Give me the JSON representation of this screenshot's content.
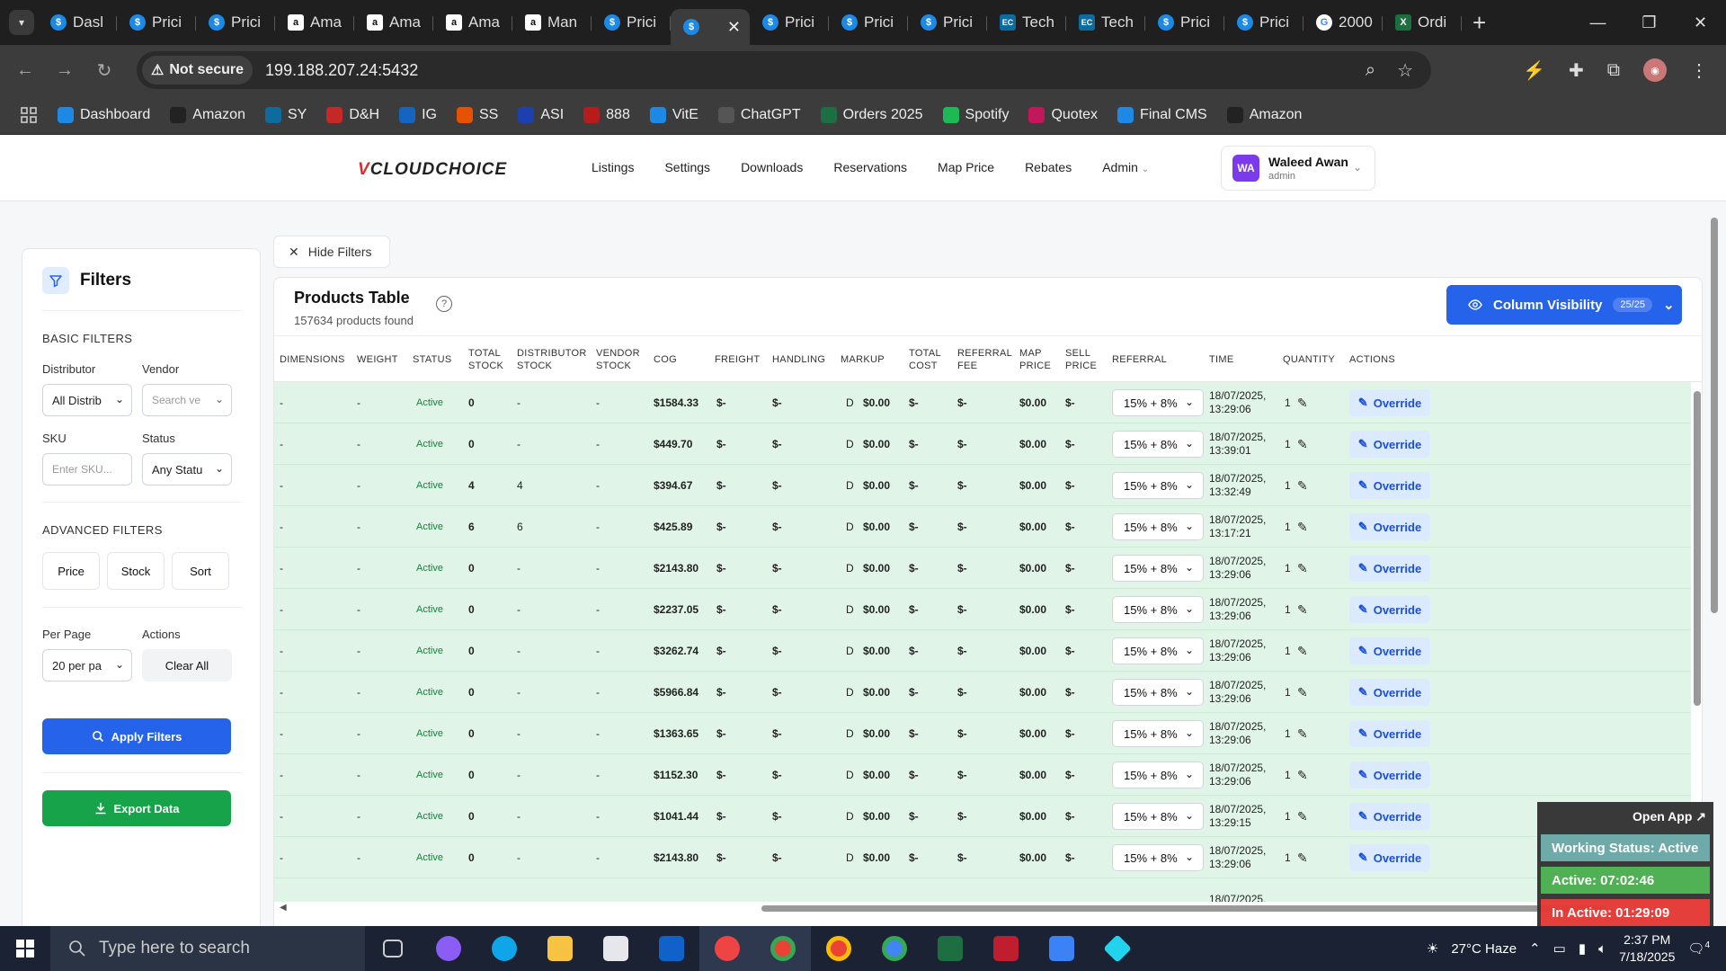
{
  "browser": {
    "tabs": [
      {
        "label": "Dasl",
        "icon": "s"
      },
      {
        "label": "Prici",
        "icon": "s"
      },
      {
        "label": "Prici",
        "icon": "s"
      },
      {
        "label": "Ama",
        "icon": "a"
      },
      {
        "label": "Ama",
        "icon": "a"
      },
      {
        "label": "Ama",
        "icon": "a"
      },
      {
        "label": "Man",
        "icon": "a"
      },
      {
        "label": "Prici",
        "icon": "s"
      },
      {
        "label": "",
        "icon": "s"
      },
      {
        "label": "Prici",
        "icon": "s"
      },
      {
        "label": "Prici",
        "icon": "s"
      },
      {
        "label": "Prici",
        "icon": "s"
      },
      {
        "label": "Tech",
        "icon": "ec"
      },
      {
        "label": "Tech",
        "icon": "ec"
      },
      {
        "label": "Prici",
        "icon": "s"
      },
      {
        "label": "Prici",
        "icon": "s"
      },
      {
        "label": "2000",
        "icon": "g"
      },
      {
        "label": "Ordi",
        "icon": "x"
      }
    ],
    "security_label": "Not secure",
    "url": "199.188.207.24:5432",
    "bookmarks": [
      {
        "label": "Dashboard",
        "color": "#1e88e5"
      },
      {
        "label": "Amazon",
        "color": "#222222"
      },
      {
        "label": "SY",
        "color": "#0d6b9e"
      },
      {
        "label": "D&H",
        "color": "#c62828"
      },
      {
        "label": "IG",
        "color": "#1565c0"
      },
      {
        "label": "SS",
        "color": "#e65100"
      },
      {
        "label": "ASI",
        "color": "#1e40af"
      },
      {
        "label": "888",
        "color": "#b71c1c"
      },
      {
        "label": "VitE",
        "color": "#1e88e5"
      },
      {
        "label": "ChatGPT",
        "color": "#555555"
      },
      {
        "label": "Orders 2025",
        "color": "#1d6f42"
      },
      {
        "label": "Spotify",
        "color": "#1db954"
      },
      {
        "label": "Quotex",
        "color": "#c2185b"
      },
      {
        "label": "Final CMS",
        "color": "#1e88e5"
      },
      {
        "label": "Amazon",
        "color": "#222222"
      }
    ]
  },
  "app": {
    "logo_v": "V",
    "logo_text": "CLOUDCHOICE",
    "nav": [
      "Listings",
      "Settings",
      "Downloads",
      "Reservations",
      "Map Price",
      "Rebates",
      "Admin"
    ],
    "user": {
      "initials": "WA",
      "name": "Waleed Awan",
      "role": "admin"
    }
  },
  "filters": {
    "title": "Filters",
    "basic_title": "BASIC FILTERS",
    "distributor_label": "Distributor",
    "distributor_value": "All Distrib",
    "vendor_label": "Vendor",
    "vendor_placeholder": "Search ve",
    "sku_label": "SKU",
    "sku_placeholder": "Enter SKU...",
    "status_label": "Status",
    "status_value": "Any Statu",
    "advanced_title": "ADVANCED FILTERS",
    "price_btn": "Price",
    "stock_btn": "Stock",
    "sort_btn": "Sort",
    "per_page_label": "Per Page",
    "per_page_value": "20 per pa",
    "actions_label": "Actions",
    "clear_all": "Clear All",
    "apply": "Apply Filters",
    "export": "Export Data"
  },
  "hide_filters": "Hide Filters",
  "table": {
    "title": "Products Table",
    "count": "157634 products found",
    "column_visibility": "Column Visibility",
    "column_badge": "25/25",
    "headers": [
      [
        "DIMENSIONS"
      ],
      [
        "WEIGHT"
      ],
      [
        "STATUS"
      ],
      [
        "TOTAL",
        "STOCK"
      ],
      [
        "DISTRIBUTOR",
        "STOCK"
      ],
      [
        "VENDOR",
        "STOCK"
      ],
      [
        "COG"
      ],
      [
        "FREIGHT"
      ],
      [
        "HANDLING"
      ],
      [
        "MARKUP"
      ],
      [
        "TOTAL",
        "COST"
      ],
      [
        "REFERRAL",
        "FEE"
      ],
      [
        "MAP",
        "PRICE"
      ],
      [
        "SELL",
        "PRICE"
      ],
      [
        "REFERRAL"
      ],
      [
        "TIME"
      ],
      [
        "QUANTITY"
      ],
      [
        "ACTIONS"
      ]
    ],
    "rows": [
      {
        "dim": "-",
        "weight": "-",
        "status": "Active",
        "total_stock": "0",
        "dist_stock": "-",
        "vendor_stock": "-",
        "cog": "$1584.33",
        "freight": "$-",
        "handling": "$-",
        "markup_d": "D",
        "markup": "$0.00",
        "total_cost": "$-",
        "ref_fee": "$-",
        "map": "$0.00",
        "sell": "$-",
        "referral": "15% + 8%",
        "date": "18/07/2025,",
        "time": "13:29:06",
        "qty": "1",
        "action": "Override"
      },
      {
        "dim": "-",
        "weight": "-",
        "status": "Active",
        "total_stock": "0",
        "dist_stock": "-",
        "vendor_stock": "-",
        "cog": "$449.70",
        "freight": "$-",
        "handling": "$-",
        "markup_d": "D",
        "markup": "$0.00",
        "total_cost": "$-",
        "ref_fee": "$-",
        "map": "$0.00",
        "sell": "$-",
        "referral": "15% + 8%",
        "date": "18/07/2025,",
        "time": "13:39:01",
        "qty": "1",
        "action": "Override"
      },
      {
        "dim": "-",
        "weight": "-",
        "status": "Active",
        "total_stock": "4",
        "dist_stock": "4",
        "vendor_stock": "-",
        "cog": "$394.67",
        "freight": "$-",
        "handling": "$-",
        "markup_d": "D",
        "markup": "$0.00",
        "total_cost": "$-",
        "ref_fee": "$-",
        "map": "$0.00",
        "sell": "$-",
        "referral": "15% + 8%",
        "date": "18/07/2025,",
        "time": "13:32:49",
        "qty": "1",
        "action": "Override"
      },
      {
        "dim": "-",
        "weight": "-",
        "status": "Active",
        "total_stock": "6",
        "dist_stock": "6",
        "vendor_stock": "-",
        "cog": "$425.89",
        "freight": "$-",
        "handling": "$-",
        "markup_d": "D",
        "markup": "$0.00",
        "total_cost": "$-",
        "ref_fee": "$-",
        "map": "$0.00",
        "sell": "$-",
        "referral": "15% + 8%",
        "date": "18/07/2025,",
        "time": "13:17:21",
        "qty": "1",
        "action": "Override"
      },
      {
        "dim": "-",
        "weight": "-",
        "status": "Active",
        "total_stock": "0",
        "dist_stock": "-",
        "vendor_stock": "-",
        "cog": "$2143.80",
        "freight": "$-",
        "handling": "$-",
        "markup_d": "D",
        "markup": "$0.00",
        "total_cost": "$-",
        "ref_fee": "$-",
        "map": "$0.00",
        "sell": "$-",
        "referral": "15% + 8%",
        "date": "18/07/2025,",
        "time": "13:29:06",
        "qty": "1",
        "action": "Override"
      },
      {
        "dim": "-",
        "weight": "-",
        "status": "Active",
        "total_stock": "0",
        "dist_stock": "-",
        "vendor_stock": "-",
        "cog": "$2237.05",
        "freight": "$-",
        "handling": "$-",
        "markup_d": "D",
        "markup": "$0.00",
        "total_cost": "$-",
        "ref_fee": "$-",
        "map": "$0.00",
        "sell": "$-",
        "referral": "15% + 8%",
        "date": "18/07/2025,",
        "time": "13:29:06",
        "qty": "1",
        "action": "Override"
      },
      {
        "dim": "-",
        "weight": "-",
        "status": "Active",
        "total_stock": "0",
        "dist_stock": "-",
        "vendor_stock": "-",
        "cog": "$3262.74",
        "freight": "$-",
        "handling": "$-",
        "markup_d": "D",
        "markup": "$0.00",
        "total_cost": "$-",
        "ref_fee": "$-",
        "map": "$0.00",
        "sell": "$-",
        "referral": "15% + 8%",
        "date": "18/07/2025,",
        "time": "13:29:06",
        "qty": "1",
        "action": "Override"
      },
      {
        "dim": "-",
        "weight": "-",
        "status": "Active",
        "total_stock": "0",
        "dist_stock": "-",
        "vendor_stock": "-",
        "cog": "$5966.84",
        "freight": "$-",
        "handling": "$-",
        "markup_d": "D",
        "markup": "$0.00",
        "total_cost": "$-",
        "ref_fee": "$-",
        "map": "$0.00",
        "sell": "$-",
        "referral": "15% + 8%",
        "date": "18/07/2025,",
        "time": "13:29:06",
        "qty": "1",
        "action": "Override"
      },
      {
        "dim": "-",
        "weight": "-",
        "status": "Active",
        "total_stock": "0",
        "dist_stock": "-",
        "vendor_stock": "-",
        "cog": "$1363.65",
        "freight": "$-",
        "handling": "$-",
        "markup_d": "D",
        "markup": "$0.00",
        "total_cost": "$-",
        "ref_fee": "$-",
        "map": "$0.00",
        "sell": "$-",
        "referral": "15% + 8%",
        "date": "18/07/2025,",
        "time": "13:29:06",
        "qty": "1",
        "action": "Override"
      },
      {
        "dim": "-",
        "weight": "-",
        "status": "Active",
        "total_stock": "0",
        "dist_stock": "-",
        "vendor_stock": "-",
        "cog": "$1152.30",
        "freight": "$-",
        "handling": "$-",
        "markup_d": "D",
        "markup": "$0.00",
        "total_cost": "$-",
        "ref_fee": "$-",
        "map": "$0.00",
        "sell": "$-",
        "referral": "15% + 8%",
        "date": "18/07/2025,",
        "time": "13:29:06",
        "qty": "1",
        "action": "Override"
      },
      {
        "dim": "-",
        "weight": "-",
        "status": "Active",
        "total_stock": "0",
        "dist_stock": "-",
        "vendor_stock": "-",
        "cog": "$1041.44",
        "freight": "$-",
        "handling": "$-",
        "markup_d": "D",
        "markup": "$0.00",
        "total_cost": "$-",
        "ref_fee": "$-",
        "map": "$0.00",
        "sell": "$-",
        "referral": "15% + 8%",
        "date": "18/07/2025,",
        "time": "13:29:15",
        "qty": "1",
        "action": "Override"
      },
      {
        "dim": "-",
        "weight": "-",
        "status": "Active",
        "total_stock": "0",
        "dist_stock": "-",
        "vendor_stock": "-",
        "cog": "$2143.80",
        "freight": "$-",
        "handling": "$-",
        "markup_d": "D",
        "markup": "$0.00",
        "total_cost": "$-",
        "ref_fee": "$-",
        "map": "$0.00",
        "sell": "$-",
        "referral": "15% + 8%",
        "date": "18/07/2025,",
        "time": "13:29:06",
        "qty": "1",
        "action": "Override"
      },
      {
        "dim": "",
        "weight": "",
        "status": "",
        "total_stock": "",
        "dist_stock": "",
        "vendor_stock": "",
        "cog": "",
        "freight": "",
        "handling": "",
        "markup_d": "",
        "markup": "",
        "total_cost": "",
        "ref_fee": "",
        "map": "",
        "sell": "",
        "referral": "",
        "date": "18/07/2025,",
        "time": "",
        "qty": "",
        "action": ""
      }
    ]
  },
  "widget": {
    "open_app": "Open App ↗",
    "working_status": "Working Status: Active",
    "active": "Active: 07:02:46",
    "inactive": "In Active: 01:29:09"
  },
  "taskbar": {
    "search_placeholder": "Type here to search",
    "weather": "27°C  Haze",
    "time": "2:37 PM",
    "date": "7/18/2025",
    "notifications": "4"
  },
  "colors": {
    "primary": "#2563eb",
    "success": "#16a34a",
    "row_bg": "#e0f5e7",
    "brand_red": "#d32f2f"
  }
}
